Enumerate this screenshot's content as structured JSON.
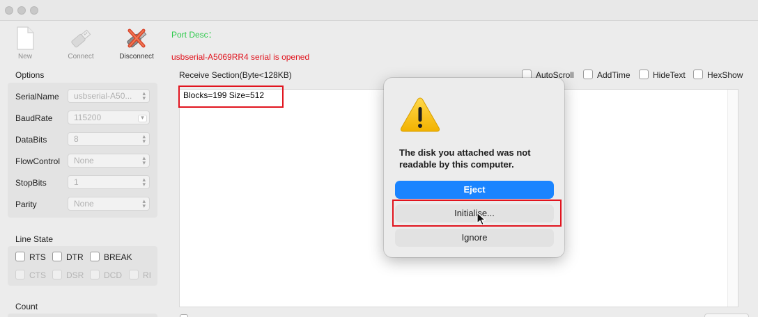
{
  "toolbar": {
    "new_label": "New",
    "connect_label": "Connect",
    "disconnect_label": "Disconnect"
  },
  "port": {
    "desc_label": "Port Desc：",
    "status": "usbserial-A5069RR4 serial is opened"
  },
  "options": {
    "title": "Options",
    "fields": [
      {
        "label": "SerialName",
        "value": "usbserial-A50..."
      },
      {
        "label": "BaudRate",
        "value": "115200"
      },
      {
        "label": "DataBits",
        "value": "8"
      },
      {
        "label": "FlowControl",
        "value": "None"
      },
      {
        "label": "StopBits",
        "value": "1"
      },
      {
        "label": "Parity",
        "value": "None"
      }
    ]
  },
  "line_state": {
    "title": "Line State",
    "outputs": [
      "RTS",
      "DTR",
      "BREAK"
    ],
    "inputs": [
      "CTS",
      "DSR",
      "DCD",
      "RI"
    ]
  },
  "count": {
    "title": "Count"
  },
  "receive": {
    "title": "Receive Section(Byte<128KB)",
    "options": [
      "AutoScroll",
      "AddTime",
      "HideText",
      "HexShow"
    ],
    "content": "Blocks=199 Size=512"
  },
  "dialog": {
    "message": "The disk you attached was not readable by this computer.",
    "eject_label": "Eject",
    "initialise_label": "Initialise...",
    "ignore_label": "Ignore"
  },
  "colors": {
    "accent_blue": "#1a84ff",
    "status_green": "#2cc94a",
    "status_red": "#e1141e",
    "highlight_red": "#e1141e",
    "warning_yellow": "#f5c518"
  },
  "icons": {
    "new": "document-icon",
    "connect": "usb-plug-icon",
    "disconnect": "usb-plug-cancel-icon",
    "alert": "warning-triangle-icon",
    "cursor": "mouse-pointer-icon"
  }
}
